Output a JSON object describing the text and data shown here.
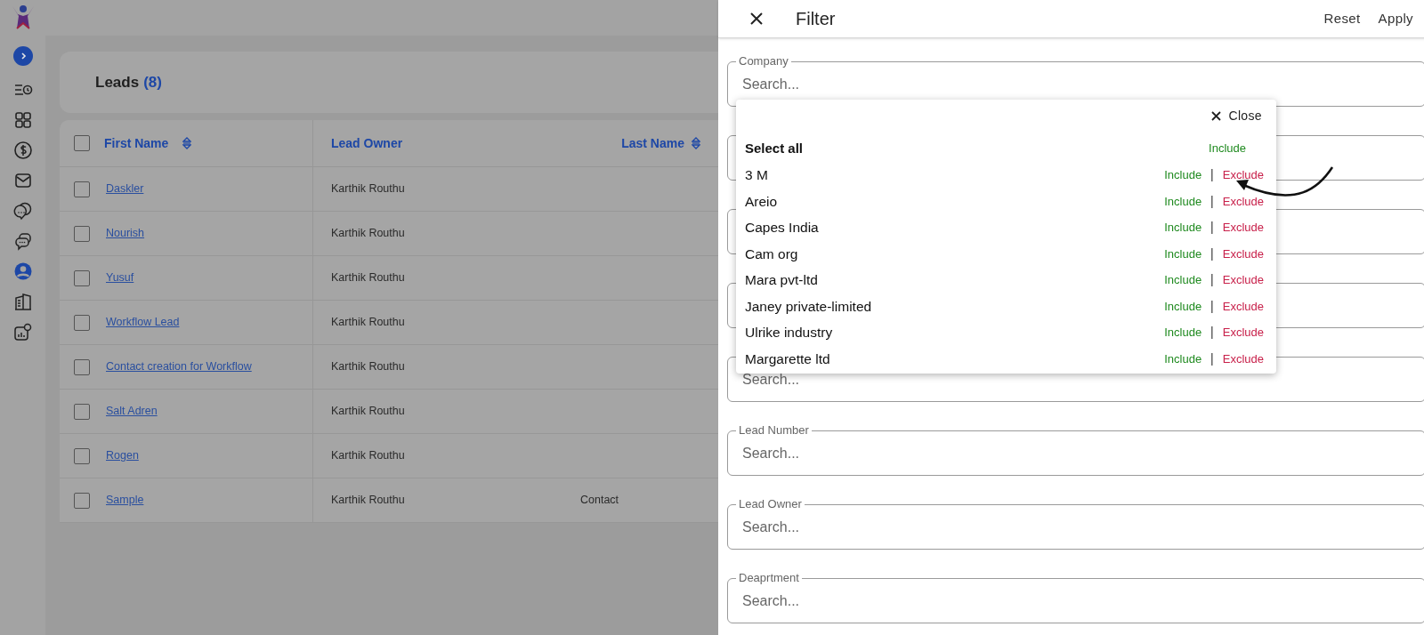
{
  "sidebar": {
    "items": [
      {
        "selected": false
      },
      {
        "selected": false
      },
      {
        "selected": false
      },
      {
        "selected": false
      },
      {
        "selected": false
      },
      {
        "selected": false
      },
      {
        "selected": true
      },
      {
        "selected": false
      },
      {
        "selected": false
      }
    ]
  },
  "leads": {
    "title": "Leads",
    "count": "(8)"
  },
  "table": {
    "select_all_checked": false,
    "columns": [
      {
        "label": "First Name",
        "sortable": true
      },
      {
        "label": "Lead Owner",
        "sortable": false
      },
      {
        "label": "Last Name",
        "sortable": true
      }
    ],
    "rows": [
      {
        "checked": false,
        "first_name": "Daskler",
        "lead_owner": "Karthik Routhu"
      },
      {
        "checked": false,
        "first_name": "Nourish",
        "lead_owner": "Karthik Routhu"
      },
      {
        "checked": false,
        "first_name": "Yusuf",
        "lead_owner": "Karthik Routhu"
      },
      {
        "checked": false,
        "first_name": "Workflow Lead",
        "lead_owner": "Karthik Routhu"
      },
      {
        "checked": false,
        "first_name": "Contact creation for Workflow",
        "lead_owner": "Karthik Routhu"
      },
      {
        "checked": false,
        "first_name": "Salt Adren",
        "lead_owner": "Karthik Routhu"
      },
      {
        "checked": false,
        "first_name": "Rogen",
        "lead_owner": "Karthik Routhu"
      },
      {
        "checked": false,
        "first_name": "Sample",
        "lead_owner": "Karthik Routhu",
        "last_name": "Contact"
      }
    ]
  },
  "filter": {
    "title": "Filter",
    "actions": [
      "Reset",
      "Apply"
    ],
    "fields": [
      {
        "kind": "field",
        "label": "Company",
        "placeholder": "Search..."
      },
      {
        "kind": "covered"
      },
      {
        "kind": "covered"
      },
      {
        "kind": "covered"
      },
      {
        "kind": "field",
        "placeholder": "Search..."
      },
      {
        "kind": "field",
        "label": "Lead Number",
        "placeholder": "Search..."
      },
      {
        "kind": "field",
        "label": "Lead Owner",
        "placeholder": "Search..."
      },
      {
        "kind": "field",
        "label": "Deaprtment",
        "placeholder": "Search..."
      }
    ],
    "dropdown": {
      "close": "Close",
      "select_all": {
        "label": "Select all",
        "include": "Include"
      },
      "options": [
        {
          "label": "3 M",
          "include": "Include",
          "separator": "|",
          "exclude": "Exclude"
        },
        {
          "label": "Areio",
          "include": "Include",
          "separator": "|",
          "exclude": "Exclude"
        },
        {
          "label": "Capes India",
          "include": "Include",
          "separator": "|",
          "exclude": "Exclude"
        },
        {
          "label": "Cam org",
          "include": "Include",
          "separator": "|",
          "exclude": "Exclude"
        },
        {
          "label": "Mara pvt-ltd",
          "include": "Include",
          "separator": "|",
          "exclude": "Exclude"
        },
        {
          "label": "Janey private-limited",
          "include": "Include",
          "separator": "|",
          "exclude": "Exclude"
        },
        {
          "label": "Ulrike industry",
          "include": "Include",
          "separator": "|",
          "exclude": "Exclude"
        },
        {
          "label": "Margarette ltd",
          "include": "Include",
          "separator": "|",
          "exclude": "Exclude"
        }
      ]
    }
  }
}
